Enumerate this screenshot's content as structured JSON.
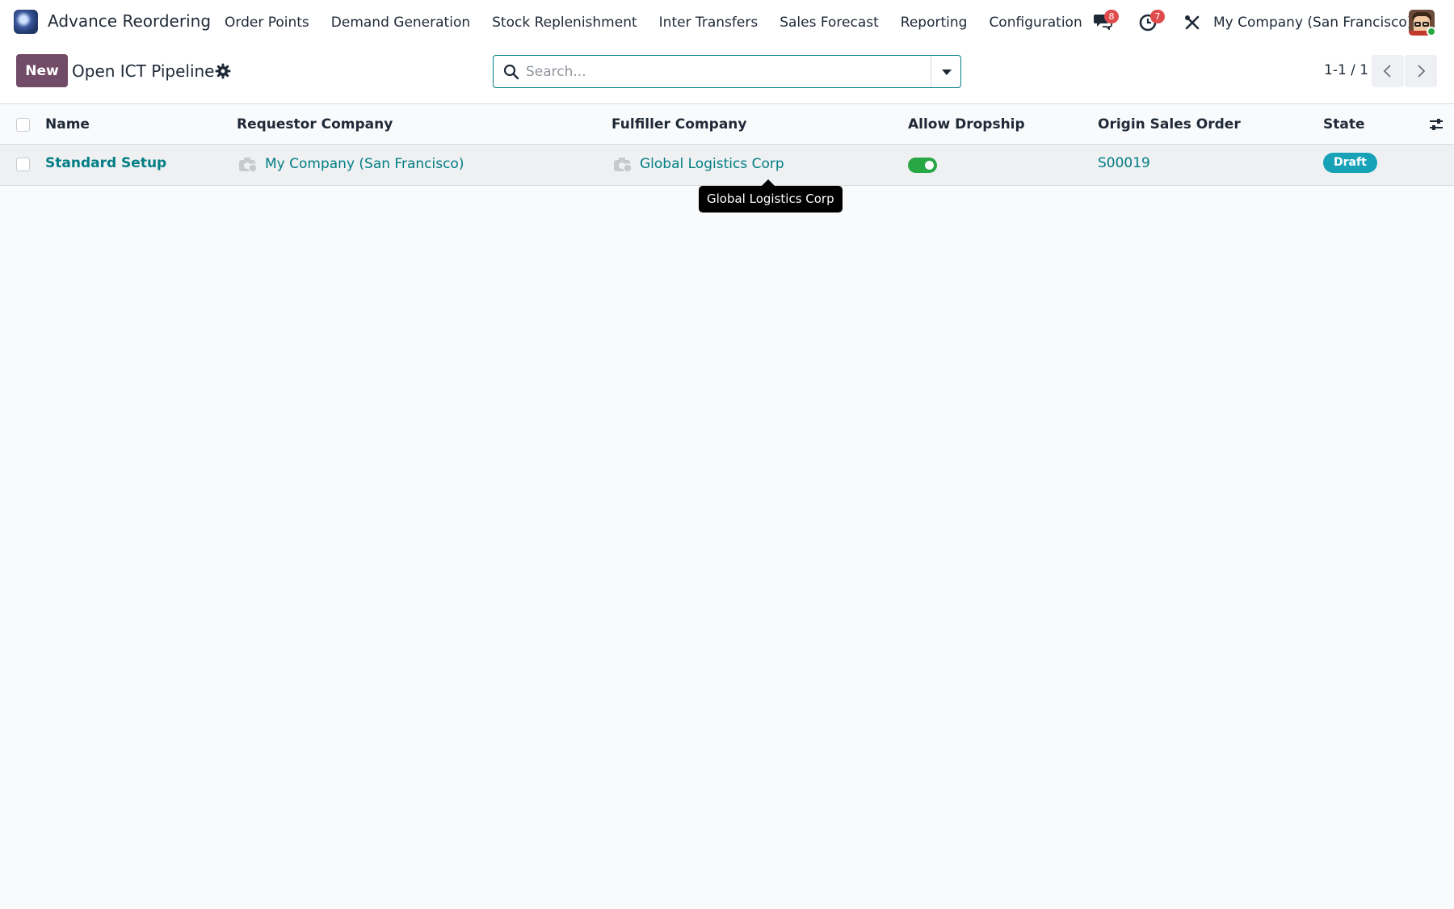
{
  "app": {
    "title": "Advance Reordering",
    "logo_icon": "app-logo-icon"
  },
  "nav": {
    "items": [
      {
        "label": "Order Points"
      },
      {
        "label": "Demand Generation"
      },
      {
        "label": "Stock Replenishment"
      },
      {
        "label": "Inter Transfers"
      },
      {
        "label": "Sales Forecast"
      },
      {
        "label": "Reporting"
      },
      {
        "label": "Configuration"
      }
    ],
    "messages_count": "8",
    "activities_count": "7",
    "company": "My Company (San Francisco)"
  },
  "control": {
    "new_label": "New",
    "title": "Open ICT Pipeline",
    "search_placeholder": "Search...",
    "pager": "1-1 / 1"
  },
  "table": {
    "columns": [
      "Name",
      "Requestor Company",
      "Fulfiller Company",
      "Allow Dropship",
      "Origin Sales Order",
      "State"
    ],
    "rows": [
      {
        "name": "Standard Setup",
        "requestor_company": "My Company (San Francisco)",
        "fulfiller_company": "Global Logistics Corp",
        "allow_dropship": true,
        "origin_sales_order": "S00019",
        "state": "Draft"
      }
    ]
  },
  "tooltip": {
    "text": "Global Logistics Corp"
  },
  "colors": {
    "brand": "#714b67",
    "link": "#017e84",
    "toggle_on": "#28a745",
    "state_draft": "#17a2b8",
    "badge": "#e04b4b"
  }
}
